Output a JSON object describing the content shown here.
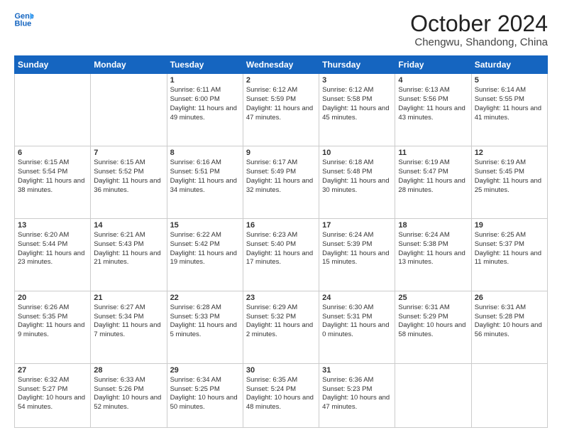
{
  "header": {
    "logo_line1": "General",
    "logo_line2": "Blue",
    "month": "October 2024",
    "location": "Chengwu, Shandong, China"
  },
  "weekdays": [
    "Sunday",
    "Monday",
    "Tuesday",
    "Wednesday",
    "Thursday",
    "Friday",
    "Saturday"
  ],
  "weeks": [
    [
      {
        "day": "",
        "content": ""
      },
      {
        "day": "",
        "content": ""
      },
      {
        "day": "1",
        "content": "Sunrise: 6:11 AM\nSunset: 6:00 PM\nDaylight: 11 hours and 49 minutes."
      },
      {
        "day": "2",
        "content": "Sunrise: 6:12 AM\nSunset: 5:59 PM\nDaylight: 11 hours and 47 minutes."
      },
      {
        "day": "3",
        "content": "Sunrise: 6:12 AM\nSunset: 5:58 PM\nDaylight: 11 hours and 45 minutes."
      },
      {
        "day": "4",
        "content": "Sunrise: 6:13 AM\nSunset: 5:56 PM\nDaylight: 11 hours and 43 minutes."
      },
      {
        "day": "5",
        "content": "Sunrise: 6:14 AM\nSunset: 5:55 PM\nDaylight: 11 hours and 41 minutes."
      }
    ],
    [
      {
        "day": "6",
        "content": "Sunrise: 6:15 AM\nSunset: 5:54 PM\nDaylight: 11 hours and 38 minutes."
      },
      {
        "day": "7",
        "content": "Sunrise: 6:15 AM\nSunset: 5:52 PM\nDaylight: 11 hours and 36 minutes."
      },
      {
        "day": "8",
        "content": "Sunrise: 6:16 AM\nSunset: 5:51 PM\nDaylight: 11 hours and 34 minutes."
      },
      {
        "day": "9",
        "content": "Sunrise: 6:17 AM\nSunset: 5:49 PM\nDaylight: 11 hours and 32 minutes."
      },
      {
        "day": "10",
        "content": "Sunrise: 6:18 AM\nSunset: 5:48 PM\nDaylight: 11 hours and 30 minutes."
      },
      {
        "day": "11",
        "content": "Sunrise: 6:19 AM\nSunset: 5:47 PM\nDaylight: 11 hours and 28 minutes."
      },
      {
        "day": "12",
        "content": "Sunrise: 6:19 AM\nSunset: 5:45 PM\nDaylight: 11 hours and 25 minutes."
      }
    ],
    [
      {
        "day": "13",
        "content": "Sunrise: 6:20 AM\nSunset: 5:44 PM\nDaylight: 11 hours and 23 minutes."
      },
      {
        "day": "14",
        "content": "Sunrise: 6:21 AM\nSunset: 5:43 PM\nDaylight: 11 hours and 21 minutes."
      },
      {
        "day": "15",
        "content": "Sunrise: 6:22 AM\nSunset: 5:42 PM\nDaylight: 11 hours and 19 minutes."
      },
      {
        "day": "16",
        "content": "Sunrise: 6:23 AM\nSunset: 5:40 PM\nDaylight: 11 hours and 17 minutes."
      },
      {
        "day": "17",
        "content": "Sunrise: 6:24 AM\nSunset: 5:39 PM\nDaylight: 11 hours and 15 minutes."
      },
      {
        "day": "18",
        "content": "Sunrise: 6:24 AM\nSunset: 5:38 PM\nDaylight: 11 hours and 13 minutes."
      },
      {
        "day": "19",
        "content": "Sunrise: 6:25 AM\nSunset: 5:37 PM\nDaylight: 11 hours and 11 minutes."
      }
    ],
    [
      {
        "day": "20",
        "content": "Sunrise: 6:26 AM\nSunset: 5:35 PM\nDaylight: 11 hours and 9 minutes."
      },
      {
        "day": "21",
        "content": "Sunrise: 6:27 AM\nSunset: 5:34 PM\nDaylight: 11 hours and 7 minutes."
      },
      {
        "day": "22",
        "content": "Sunrise: 6:28 AM\nSunset: 5:33 PM\nDaylight: 11 hours and 5 minutes."
      },
      {
        "day": "23",
        "content": "Sunrise: 6:29 AM\nSunset: 5:32 PM\nDaylight: 11 hours and 2 minutes."
      },
      {
        "day": "24",
        "content": "Sunrise: 6:30 AM\nSunset: 5:31 PM\nDaylight: 11 hours and 0 minutes."
      },
      {
        "day": "25",
        "content": "Sunrise: 6:31 AM\nSunset: 5:29 PM\nDaylight: 10 hours and 58 minutes."
      },
      {
        "day": "26",
        "content": "Sunrise: 6:31 AM\nSunset: 5:28 PM\nDaylight: 10 hours and 56 minutes."
      }
    ],
    [
      {
        "day": "27",
        "content": "Sunrise: 6:32 AM\nSunset: 5:27 PM\nDaylight: 10 hours and 54 minutes."
      },
      {
        "day": "28",
        "content": "Sunrise: 6:33 AM\nSunset: 5:26 PM\nDaylight: 10 hours and 52 minutes."
      },
      {
        "day": "29",
        "content": "Sunrise: 6:34 AM\nSunset: 5:25 PM\nDaylight: 10 hours and 50 minutes."
      },
      {
        "day": "30",
        "content": "Sunrise: 6:35 AM\nSunset: 5:24 PM\nDaylight: 10 hours and 48 minutes."
      },
      {
        "day": "31",
        "content": "Sunrise: 6:36 AM\nSunset: 5:23 PM\nDaylight: 10 hours and 47 minutes."
      },
      {
        "day": "",
        "content": ""
      },
      {
        "day": "",
        "content": ""
      }
    ]
  ]
}
